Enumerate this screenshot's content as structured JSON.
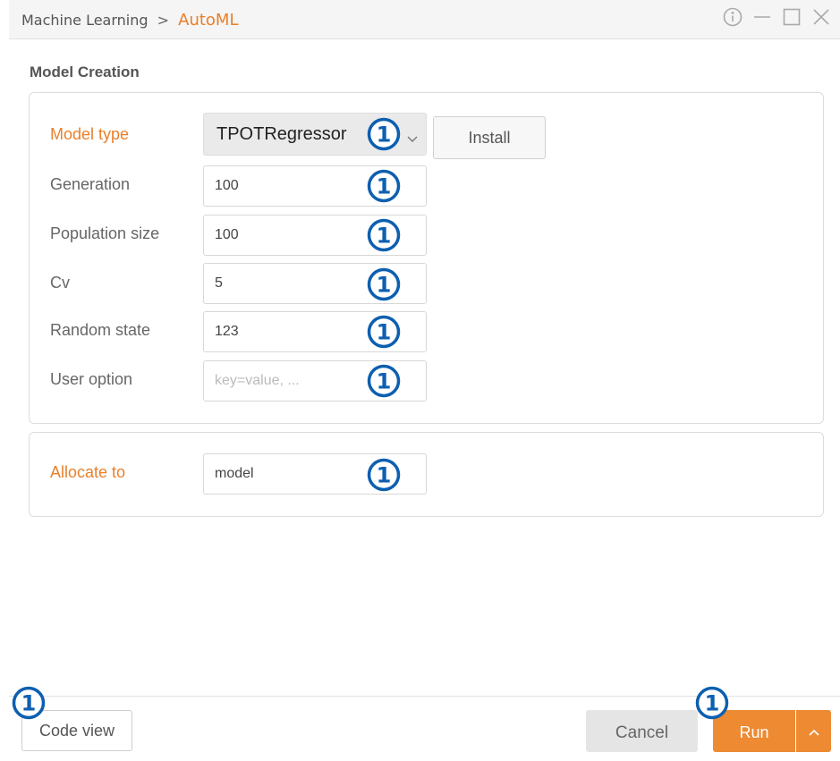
{
  "window": {
    "breadcrumb_parent": "Machine Learning",
    "breadcrumb_separator": ">",
    "breadcrumb_current": "AutoML",
    "controls": [
      "info-icon",
      "minimize-icon",
      "maximize-icon",
      "close-icon"
    ]
  },
  "model_creation": {
    "title": "Model Creation",
    "model_type": {
      "label": "Model type",
      "selected": "TPOTRegressor"
    },
    "install_label": "Install",
    "fields": [
      {
        "label": "Generation",
        "value": "100",
        "placeholder": ""
      },
      {
        "label": "Population size",
        "value": "100",
        "placeholder": ""
      },
      {
        "label": "Cv",
        "value": "5",
        "placeholder": ""
      },
      {
        "label": "Random state",
        "value": "123",
        "placeholder": ""
      },
      {
        "label": "User option",
        "value": "",
        "placeholder": "key=value, ..."
      }
    ]
  },
  "allocate": {
    "label": "Allocate to",
    "value": "model"
  },
  "footer": {
    "code_view_label": "Code view",
    "cancel_label": "Cancel",
    "run_label": "Run"
  },
  "annotation_marker": "1",
  "colors": {
    "accent": "#e87f2a",
    "run_button": "#ee8a32",
    "marker": "#0d5fb0"
  }
}
